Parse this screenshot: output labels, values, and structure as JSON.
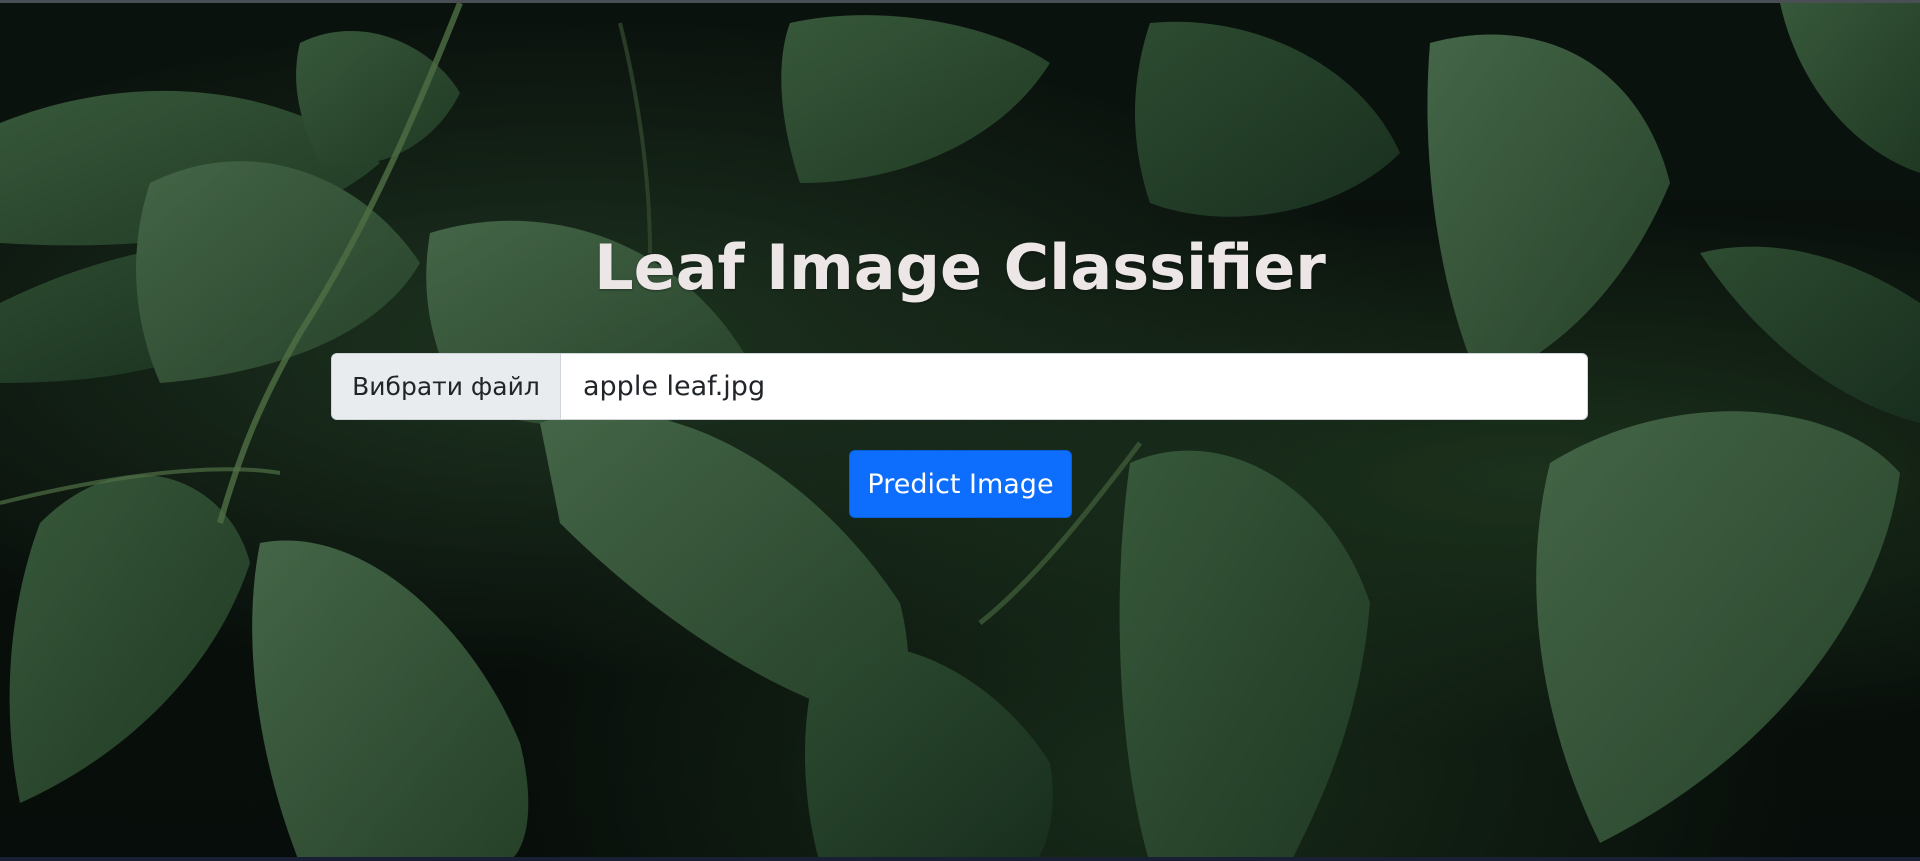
{
  "page": {
    "title": "Leaf Image Classifier"
  },
  "upload": {
    "choose_file_label": "Вибрати файл",
    "file_name": "apple leaf.jpg"
  },
  "actions": {
    "predict_label": "Predict Image"
  },
  "colors": {
    "primary": "#0d6efd",
    "title_text": "#ece6e6",
    "file_button_bg": "#e9ecef"
  }
}
